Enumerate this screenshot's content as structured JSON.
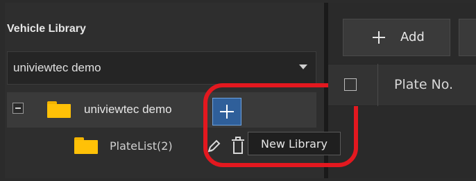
{
  "library_panel": {
    "title": "Vehicle Library",
    "selector": {
      "value": "univiewtec demo"
    },
    "tree": {
      "root": {
        "label": "univiewtec demo"
      },
      "child": {
        "label": "PlateList(2)"
      }
    },
    "tooltip": "New Library"
  },
  "toolbar": {
    "add_label": "Add"
  },
  "table": {
    "columns": [
      "",
      "Plate No."
    ]
  },
  "colors": {
    "accent": "#2f5f9a",
    "highlight_mark": "#e3181f",
    "folder": "#ffc107"
  },
  "icons": [
    "collapse-icon",
    "folder-icon",
    "plus-icon",
    "edit-icon",
    "trash-icon",
    "chevron-down-icon"
  ]
}
